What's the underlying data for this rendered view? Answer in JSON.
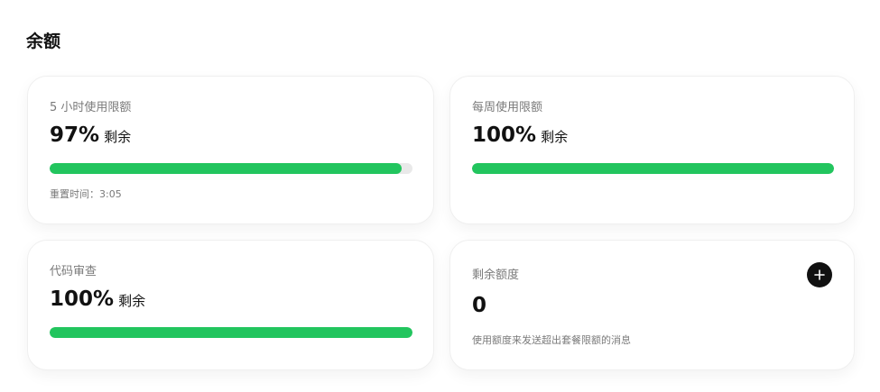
{
  "page": {
    "title": "余额"
  },
  "cards": {
    "five_hour": {
      "label": "5 小时使用限额",
      "value": "97%",
      "suffix": "剩余",
      "progress": 0.97,
      "reset_text": "重置时间：3:05"
    },
    "weekly": {
      "label": "每周使用限额",
      "value": "100%",
      "suffix": "剩余",
      "progress": 1.0
    },
    "code_review": {
      "label": "代码审查",
      "value": "100%",
      "suffix": "剩余",
      "progress": 1.0
    },
    "credits": {
      "label": "剩余额度",
      "value": "0",
      "note": "使用额度来发送超出套餐限额的消息",
      "add_icon": "plus-icon"
    }
  },
  "colors": {
    "progress_fill": "#22c55e",
    "progress_track": "#e9e9e9",
    "add_button": "#111111"
  }
}
